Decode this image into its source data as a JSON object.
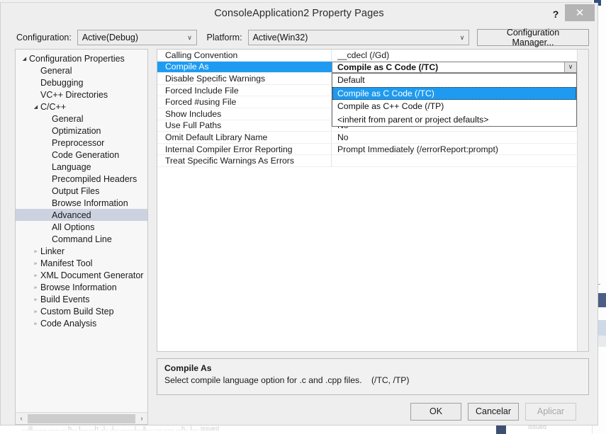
{
  "window": {
    "title": "ConsoleApplication2 Property Pages",
    "help_label": "?",
    "close_label": "✕"
  },
  "toolbar": {
    "configuration_label": "Configuration:",
    "configuration_value": "Active(Debug)",
    "platform_label": "Platform:",
    "platform_value": "Active(Win32)",
    "configuration_manager_label": "Configuration Manager...",
    "caret": "∨"
  },
  "tree": {
    "items": [
      {
        "label": "Configuration Properties",
        "indent": 0,
        "arrow": "◢",
        "selected": false
      },
      {
        "label": "General",
        "indent": 1,
        "arrow": "",
        "selected": false
      },
      {
        "label": "Debugging",
        "indent": 1,
        "arrow": "",
        "selected": false
      },
      {
        "label": "VC++ Directories",
        "indent": 1,
        "arrow": "",
        "selected": false
      },
      {
        "label": "C/C++",
        "indent": 1,
        "arrow": "◢",
        "selected": false
      },
      {
        "label": "General",
        "indent": 2,
        "arrow": "",
        "selected": false
      },
      {
        "label": "Optimization",
        "indent": 2,
        "arrow": "",
        "selected": false
      },
      {
        "label": "Preprocessor",
        "indent": 2,
        "arrow": "",
        "selected": false
      },
      {
        "label": "Code Generation",
        "indent": 2,
        "arrow": "",
        "selected": false
      },
      {
        "label": "Language",
        "indent": 2,
        "arrow": "",
        "selected": false
      },
      {
        "label": "Precompiled Headers",
        "indent": 2,
        "arrow": "",
        "selected": false
      },
      {
        "label": "Output Files",
        "indent": 2,
        "arrow": "",
        "selected": false
      },
      {
        "label": "Browse Information",
        "indent": 2,
        "arrow": "",
        "selected": false
      },
      {
        "label": "Advanced",
        "indent": 2,
        "arrow": "",
        "selected": true
      },
      {
        "label": "All Options",
        "indent": 2,
        "arrow": "",
        "selected": false
      },
      {
        "label": "Command Line",
        "indent": 2,
        "arrow": "",
        "selected": false
      },
      {
        "label": "Linker",
        "indent": 1,
        "arrow": "▹",
        "selected": false
      },
      {
        "label": "Manifest Tool",
        "indent": 1,
        "arrow": "▹",
        "selected": false
      },
      {
        "label": "XML Document Generator",
        "indent": 1,
        "arrow": "▹",
        "selected": false
      },
      {
        "label": "Browse Information",
        "indent": 1,
        "arrow": "▹",
        "selected": false
      },
      {
        "label": "Build Events",
        "indent": 1,
        "arrow": "▹",
        "selected": false
      },
      {
        "label": "Custom Build Step",
        "indent": 1,
        "arrow": "▹",
        "selected": false
      },
      {
        "label": "Code Analysis",
        "indent": 1,
        "arrow": "▹",
        "selected": false
      }
    ],
    "scroll_left_label": "‹",
    "scroll_right_label": "›"
  },
  "grid": {
    "rows": [
      {
        "name": "Calling Convention",
        "value": "__cdecl (/Gd)",
        "selected": false
      },
      {
        "name": "Compile As",
        "value": "Compile as C Code (/TC)",
        "selected": true
      },
      {
        "name": "Disable Specific Warnings",
        "value": "",
        "selected": false
      },
      {
        "name": "Forced Include File",
        "value": "",
        "selected": false
      },
      {
        "name": "Forced #using File",
        "value": "",
        "selected": false
      },
      {
        "name": "Show Includes",
        "value": "",
        "selected": false
      },
      {
        "name": "Use Full Paths",
        "value": "No",
        "selected": false
      },
      {
        "name": "Omit Default Library Name",
        "value": "No",
        "selected": false
      },
      {
        "name": "Internal Compiler Error Reporting",
        "value": "Prompt Immediately (/errorReport:prompt)",
        "selected": false
      },
      {
        "name": "Treat Specific Warnings As Errors",
        "value": "",
        "selected": false
      }
    ],
    "editor": {
      "value": "Compile as C Code (/TC)",
      "caret": "∨"
    },
    "dropdown": {
      "open": true,
      "options": [
        {
          "label": "Default",
          "highlight": false
        },
        {
          "label": "Compile as C Code (/TC)",
          "highlight": true
        },
        {
          "label": "Compile as C++ Code (/TP)",
          "highlight": false
        },
        {
          "label": "<inherit from parent or project defaults>",
          "highlight": false
        }
      ]
    }
  },
  "description": {
    "title": "Compile As",
    "body": "Select compile language option for .c and .cpp files.    (/TC, /TP)"
  },
  "footer": {
    "ok_label": "OK",
    "cancel_label": "Cancelar",
    "apply_label": "Aplicar"
  },
  "background": {
    "bottom_text": "....ill........ ...... ... h... t.... ...h ..l.. .l...                              ........l....li.... .... ...... ...h.. l....                     issued",
    "right_glyph": "│"
  },
  "colors": {
    "accent": "#1e9bf0",
    "dialog_bg": "#eeeeee",
    "tree_selected": "#cdd2e0",
    "grid_bg": "#ffffff",
    "close_button": "#b4b4b4"
  }
}
